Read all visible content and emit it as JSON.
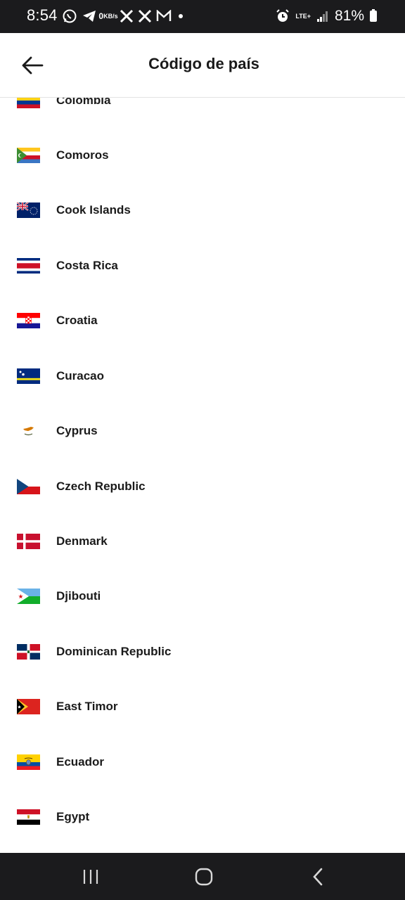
{
  "status_bar": {
    "time": "8:54",
    "speed_value": "0",
    "speed_unit": "KB/s",
    "lte_label": "LTE+",
    "battery_text": "81%",
    "icons_left": [
      "whatsapp-icon",
      "telegram-icon",
      "x-icon",
      "x-icon",
      "gmail-icon"
    ],
    "icons_right": [
      "alarm-icon",
      "signal-icon",
      "battery-icon"
    ]
  },
  "header": {
    "title": "Código de país",
    "back_icon": "arrow-left-icon"
  },
  "countries": [
    {
      "name": "Colombia",
      "flag": "colombia"
    },
    {
      "name": "Comoros",
      "flag": "comoros"
    },
    {
      "name": "Cook Islands",
      "flag": "cook-islands"
    },
    {
      "name": "Costa Rica",
      "flag": "costa-rica"
    },
    {
      "name": "Croatia",
      "flag": "croatia"
    },
    {
      "name": "Curacao",
      "flag": "curacao"
    },
    {
      "name": "Cyprus",
      "flag": "cyprus"
    },
    {
      "name": "Czech Republic",
      "flag": "czech-republic"
    },
    {
      "name": "Denmark",
      "flag": "denmark"
    },
    {
      "name": "Djibouti",
      "flag": "djibouti"
    },
    {
      "name": "Dominican Republic",
      "flag": "dominican-republic"
    },
    {
      "name": "East Timor",
      "flag": "east-timor"
    },
    {
      "name": "Ecuador",
      "flag": "ecuador"
    },
    {
      "name": "Egypt",
      "flag": "egypt"
    }
  ],
  "nav_bar": {
    "items": [
      "recents-icon",
      "home-icon",
      "back-icon"
    ]
  },
  "colors": {
    "status_bar_bg": "#1b1b1d",
    "text": "#1a1a1a",
    "divider": "#e3e3e3"
  }
}
